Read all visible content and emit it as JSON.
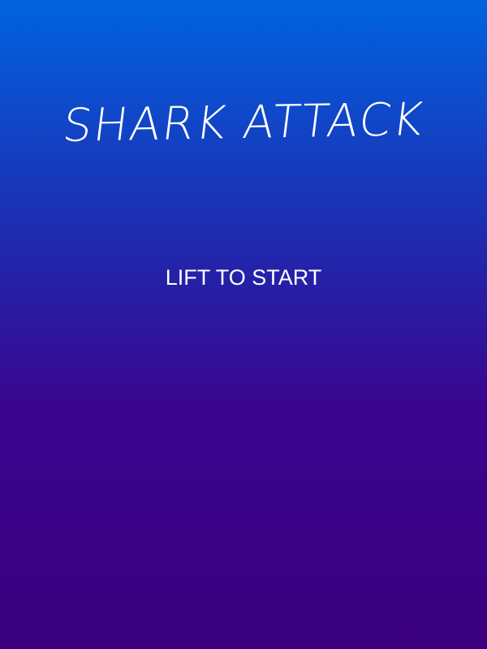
{
  "game": {
    "title": "SHARK ATTACK",
    "start_prompt": "LIFT TO START"
  },
  "colors": {
    "background_top": "#0063e0",
    "background_bottom": "#3a007e",
    "text": "#ffffff"
  }
}
